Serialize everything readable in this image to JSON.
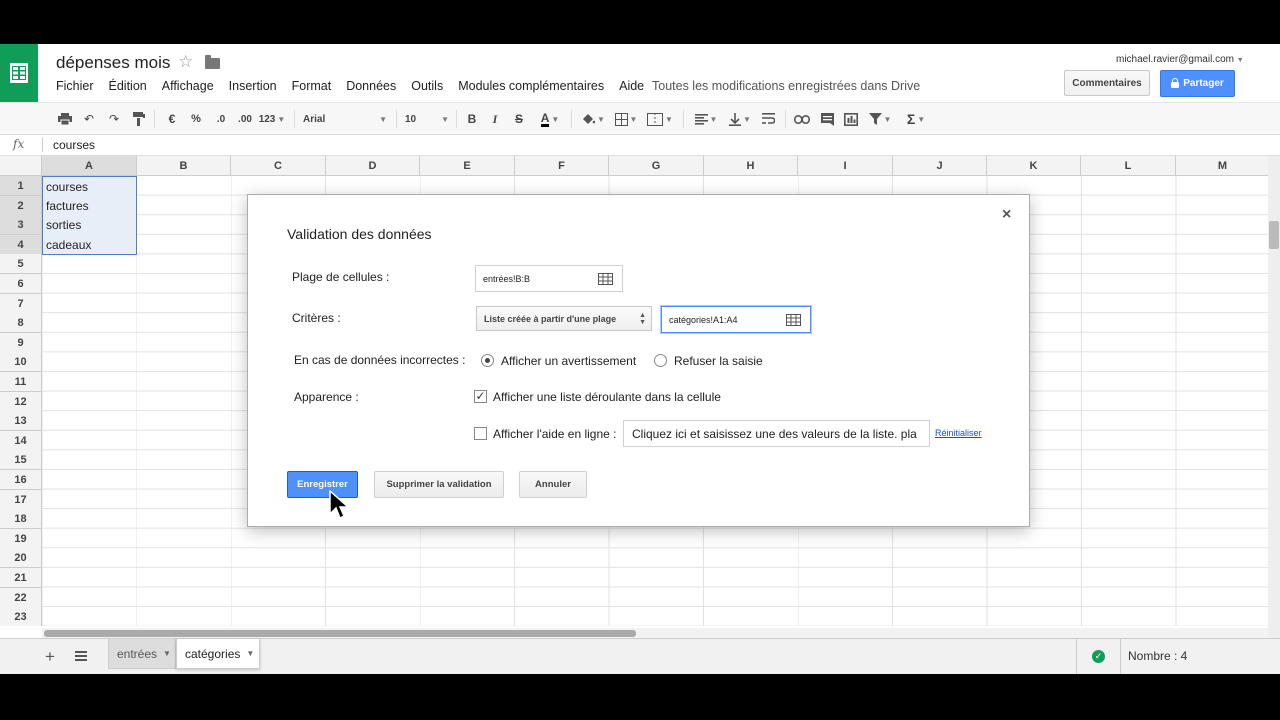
{
  "doc": {
    "title": "dépenses mois",
    "account": "michael.ravier@gmail.com"
  },
  "menu": [
    "Fichier",
    "Édition",
    "Affichage",
    "Insertion",
    "Format",
    "Données",
    "Outils",
    "Modules complémentaires",
    "Aide"
  ],
  "saved_status": "Toutes les modifications enregistrées dans Drive",
  "buttons": {
    "comments": "Commentaires",
    "share": "Partager"
  },
  "toolbar": {
    "currency": "€",
    "percent": "%",
    "dec_less": ".0",
    "dec_more": ".00",
    "number_format": "123",
    "font": "Arial",
    "font_size": "10",
    "bold": "B",
    "italic": "I",
    "strike": "S",
    "text_color": "A",
    "sum": "Σ"
  },
  "formula_bar": {
    "fx": "fx",
    "value": "courses"
  },
  "columns": [
    "A",
    "B",
    "C",
    "D",
    "E",
    "F",
    "G",
    "H",
    "I",
    "J",
    "K",
    "L",
    "M"
  ],
  "rows": [
    "1",
    "2",
    "3",
    "4",
    "5",
    "6",
    "7",
    "8",
    "9",
    "10",
    "11",
    "12",
    "13",
    "14",
    "15",
    "16",
    "17",
    "18",
    "19",
    "20",
    "21",
    "22",
    "23"
  ],
  "cells": [
    "courses",
    "factures",
    "sorties",
    "cadeaux"
  ],
  "dialog": {
    "title": "Validation des données",
    "close": "×",
    "range_label": "Plage de cellules :",
    "range_value": "entrées!B:B",
    "criteria_label": "Critères :",
    "criteria_select": "Liste créée à partir d'une plage",
    "criteria_value": "catégories!A1:A4",
    "invalid_label": "En cas de données incorrectes :",
    "option_warn": "Afficher un avertissement",
    "option_reject": "Refuser la saisie",
    "appearance_label": "Apparence :",
    "dropdown_option": "Afficher une liste déroulante dans la cellule",
    "help_option": "Afficher l'aide en ligne :",
    "help_text": "Cliquez ici et saisissez une des valeurs de la liste. pla",
    "reset": "Réinitialiser",
    "save": "Enregistrer",
    "remove": "Supprimer la validation",
    "cancel": "Annuler",
    "state": {
      "warn_selected": true,
      "dropdown_checked": true,
      "help_checked": false
    }
  },
  "sheets": [
    "entrées",
    "catégories"
  ],
  "active_sheet": "catégories",
  "status": {
    "sum": "Nombre : 4"
  },
  "colors": {
    "green": "#0f9d58",
    "blue": "#4d90fe",
    "selection": "#e8eef8"
  }
}
